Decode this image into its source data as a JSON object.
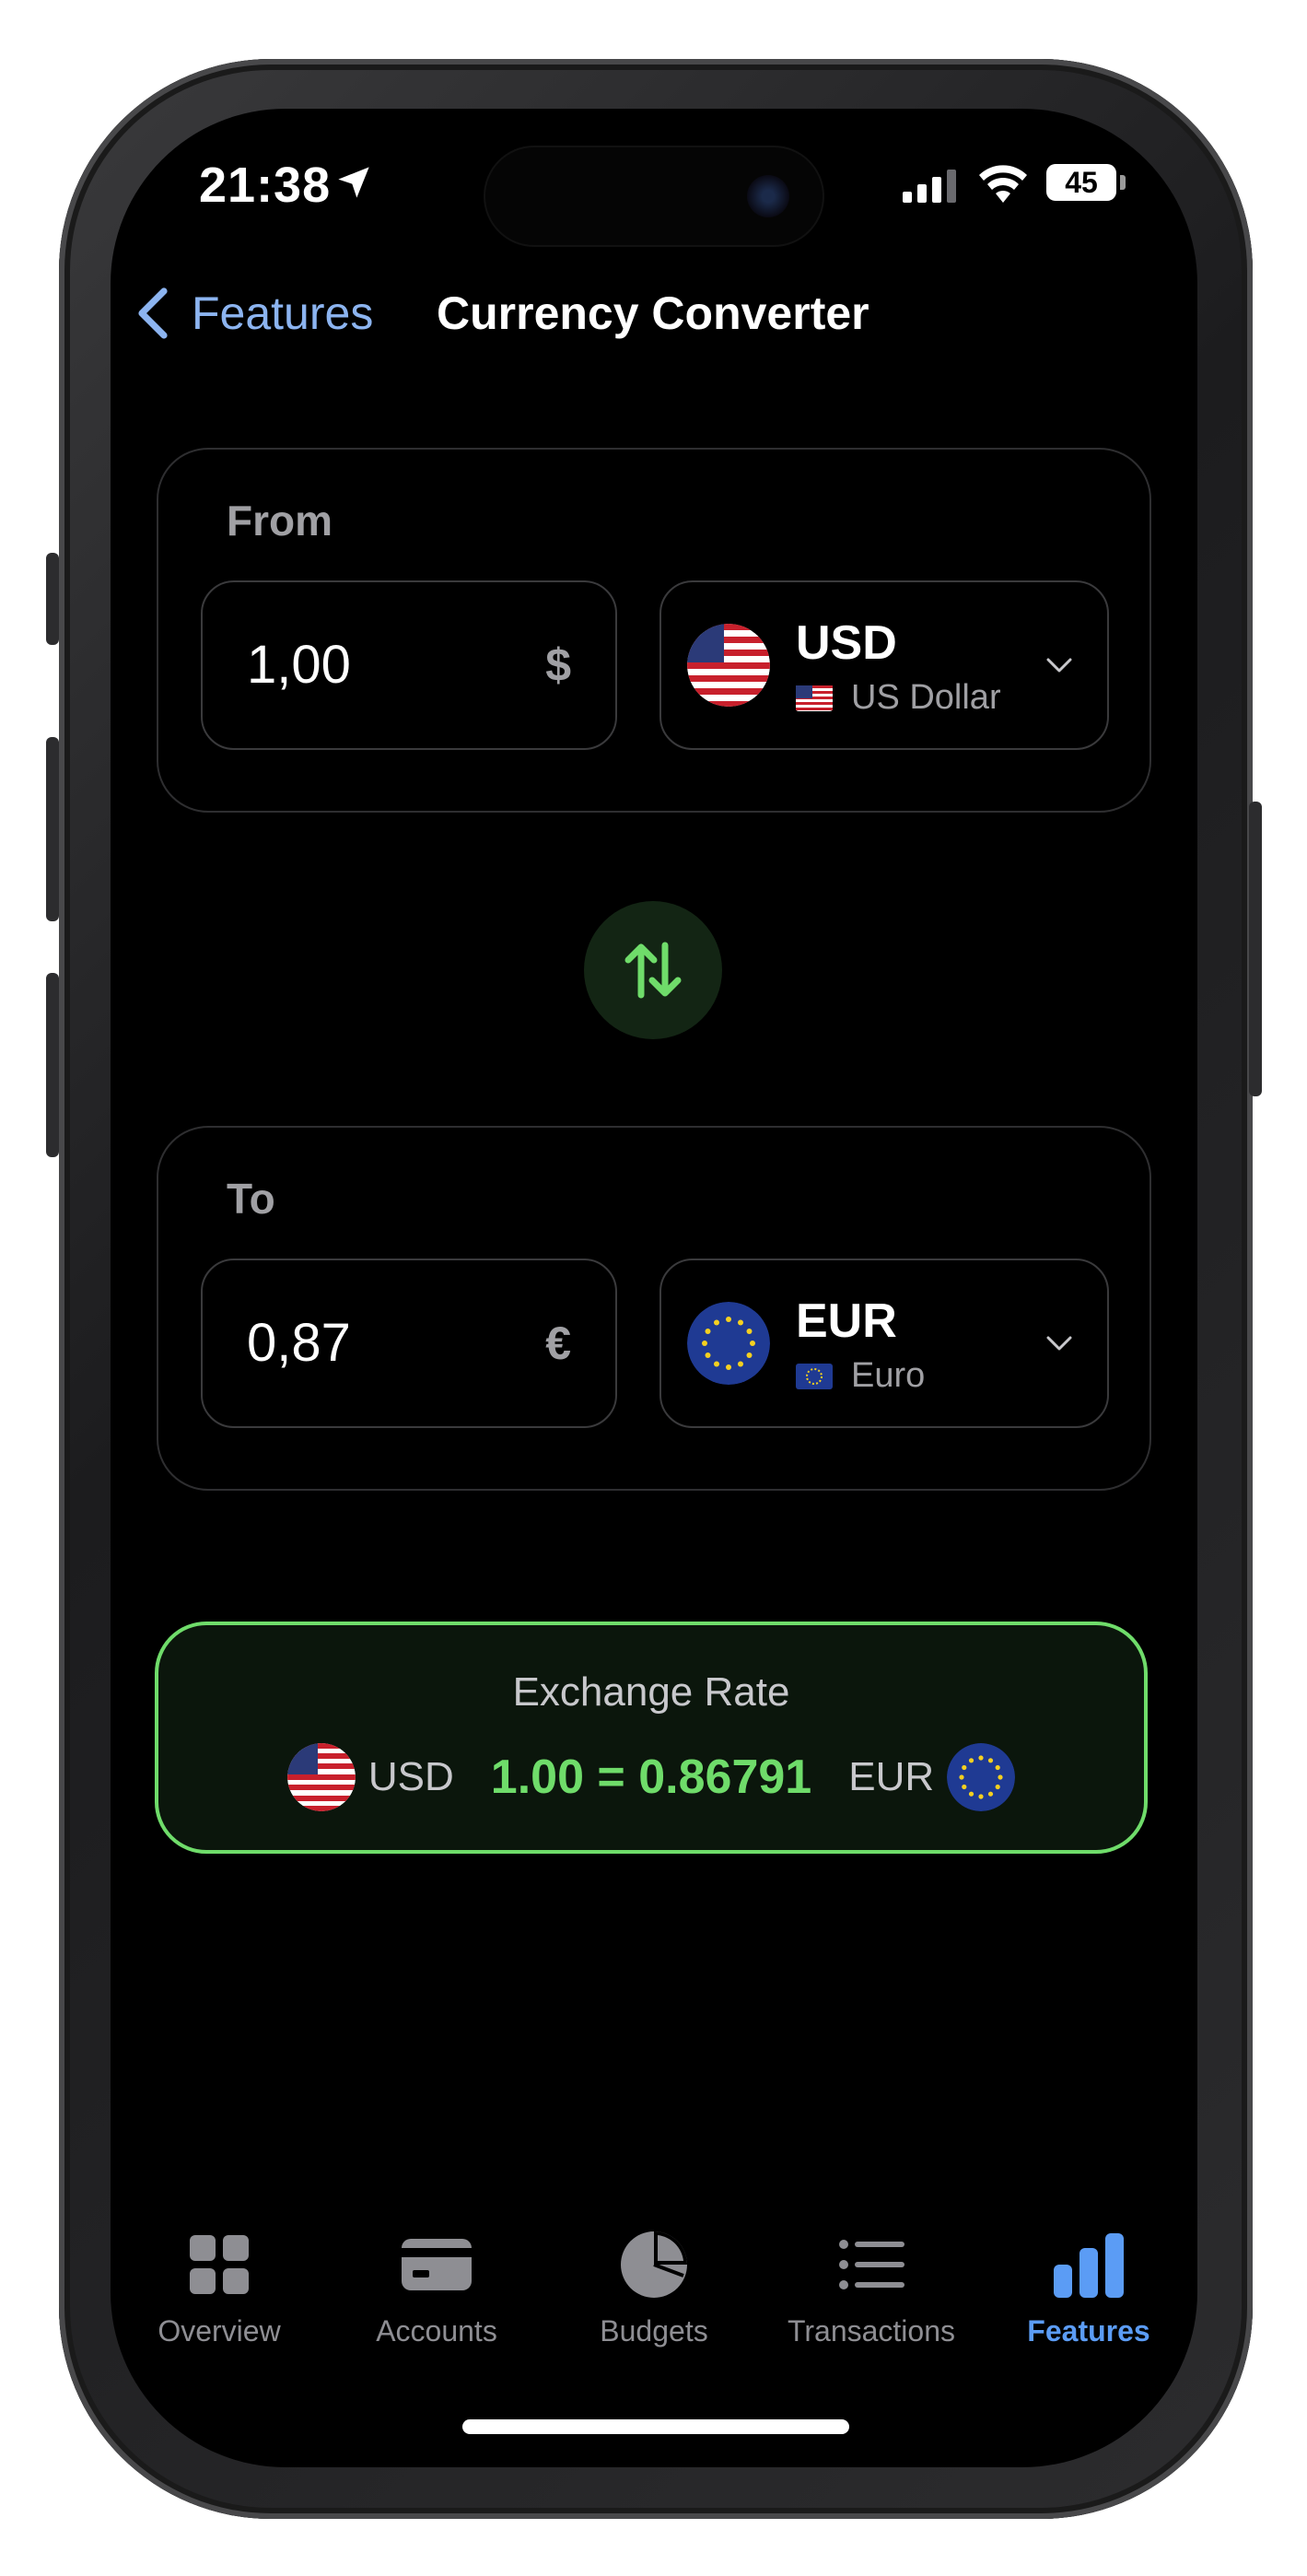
{
  "status_bar": {
    "time": "21:38",
    "battery": "45"
  },
  "nav": {
    "back_label": "Features",
    "title": "Currency Converter"
  },
  "from": {
    "label": "From",
    "amount": "1,00",
    "symbol": "$",
    "currency_code": "USD",
    "currency_name": "US Dollar"
  },
  "to": {
    "label": "To",
    "amount": "0,87",
    "symbol": "€",
    "currency_code": "EUR",
    "currency_name": "Euro"
  },
  "exchange_rate": {
    "title": "Exchange Rate",
    "from_code": "USD",
    "value": "1.00 = 0.86791",
    "to_code": "EUR"
  },
  "tabs": [
    {
      "label": "Overview",
      "icon": "grid-icon"
    },
    {
      "label": "Accounts",
      "icon": "card-icon"
    },
    {
      "label": "Budgets",
      "icon": "pie-chart-icon"
    },
    {
      "label": "Transactions",
      "icon": "list-icon"
    },
    {
      "label": "Features",
      "icon": "bar-chart-icon",
      "active": true
    }
  ],
  "colors": {
    "accent_green": "#6fdc6a",
    "accent_blue": "#5b9cf5",
    "back_link": "#8cb4f0",
    "background": "#000000"
  }
}
